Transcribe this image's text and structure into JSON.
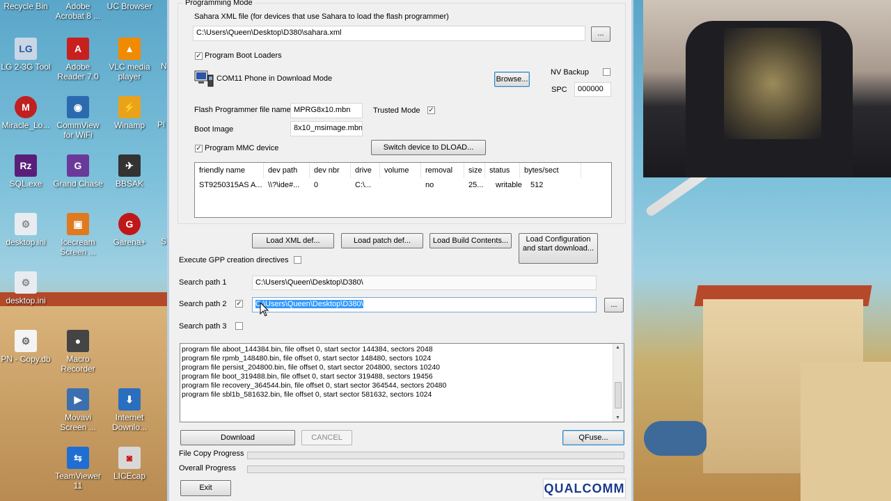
{
  "desktop": {
    "icons_col1": [
      {
        "label": "Recycle Bin",
        "icon": "recycle-bin-icon"
      },
      {
        "label": "LG 2-3G Tool",
        "icon": "lg-tool-icon"
      },
      {
        "label": "Miracle_Lo...",
        "icon": "miracle-icon"
      },
      {
        "label": "SQL.exe",
        "icon": "razer-icon"
      },
      {
        "label": "desktop.ini",
        "icon": "ini-file-icon"
      },
      {
        "label": "desktop.ini",
        "icon": "ini-file-icon"
      },
      {
        "label": "PN - Copy.db",
        "icon": "db-file-icon"
      }
    ],
    "icons_col2": [
      {
        "label": "Adobe Acrobat 8 ...",
        "icon": "acrobat-icon"
      },
      {
        "label": "Adobe Reader 7.0",
        "icon": "adobe-reader-icon"
      },
      {
        "label": "CommView for WiFi",
        "icon": "commview-icon"
      },
      {
        "label": "Grand Chase",
        "icon": "grand-chase-icon"
      },
      {
        "label": "Icecream Screen ...",
        "icon": "icecream-icon"
      },
      {
        "label": "Macro Recorder",
        "icon": "macro-recorder-icon"
      },
      {
        "label": "Movavi Screen ...",
        "icon": "movavi-icon"
      },
      {
        "label": "TeamViewer 11",
        "icon": "teamviewer-icon"
      }
    ],
    "icons_col3": [
      {
        "label": "UC Browser",
        "icon": "uc-browser-icon"
      },
      {
        "label": "VLC media player",
        "icon": "vlc-icon"
      },
      {
        "label": "Winamp",
        "icon": "winamp-icon"
      },
      {
        "label": "BBSAK",
        "icon": "bbsak-icon"
      },
      {
        "label": "Garena+",
        "icon": "garena-icon"
      },
      {
        "label": "Internet Downlo...",
        "icon": "idm-icon"
      },
      {
        "label": "LICEcap",
        "icon": "licecap-icon"
      }
    ],
    "partial_labels": [
      "N",
      "Pl",
      "S"
    ]
  },
  "app": {
    "group_title": "Programming Mode",
    "sahara_label": "Sahara XML file (for devices that use Sahara to load the flash programmer)",
    "sahara_path": "C:\\Users\\Queen\\Desktop\\D380\\sahara.xml",
    "ellipsis": "...",
    "program_boot_loaders": "Program Boot Loaders",
    "port_text": "COM11  Phone in Download Mode",
    "browse": "Browse...",
    "nv_backup": "NV Backup",
    "spc_label": "SPC",
    "spc_value": "000000",
    "flash_prog_label": "Flash Programmer file name",
    "flash_prog_value": "MPRG8x10.mbn",
    "trusted_mode": "Trusted Mode",
    "boot_image_label": "Boot Image",
    "boot_image_value": "8x10_msimage.mbn",
    "program_mmc": "Program MMC device",
    "switch_dload": "Switch device to DLOAD...",
    "table": {
      "columns": [
        "friendly name",
        "dev path",
        "dev nbr",
        "drive",
        "volume",
        "removal",
        "size",
        "status",
        "bytes/sect"
      ],
      "rows": [
        [
          "ST9250315AS A...",
          "\\\\?\\ide#...",
          "0",
          "C:\\...",
          "",
          "no",
          "25...",
          "writable",
          "512"
        ]
      ]
    },
    "load_xml": "Load XML def...",
    "load_patch": "Load patch def...",
    "load_build": "Load Build Contents...",
    "load_config_1": "Load Configuration",
    "load_config_2": "and start download...",
    "exec_gpp": "Execute GPP creation directives",
    "search_path1_label": "Search path 1",
    "search_path1_value": "C:\\Users\\Queen\\Desktop\\D380\\",
    "search_path2_label": "Search path 2",
    "search_path2_value": "C:\\Users\\Queen\\Desktop\\D380\\",
    "search_path3_label": "Search path 3",
    "log_lines": [
      "program file aboot_144384.bin, file offset 0, start sector 144384, sectors 2048",
      "program file rpmb_148480.bin, file offset 0, start sector 148480, sectors 1024",
      "program file persist_204800.bin, file offset 0, start sector 204800, sectors 10240",
      "program file boot_319488.bin, file offset 0, start sector 319488, sectors 19456",
      "program file recovery_364544.bin, file offset 0, start sector 364544, sectors 20480",
      "program file sbl1b_581632.bin, file offset 0, start sector 581632, sectors 1024"
    ],
    "download": "Download",
    "cancel": "CANCEL",
    "qfuse": "QFuse...",
    "file_copy_progress": "File Copy Progress",
    "overall_progress": "Overall Progress",
    "file_copy_value": 0,
    "overall_value": 0,
    "exit": "Exit",
    "logo": "QUALCOMM",
    "checkmark": "✓"
  },
  "colors": {
    "progress_fill": "#06b025",
    "selection": "#3399ff"
  }
}
